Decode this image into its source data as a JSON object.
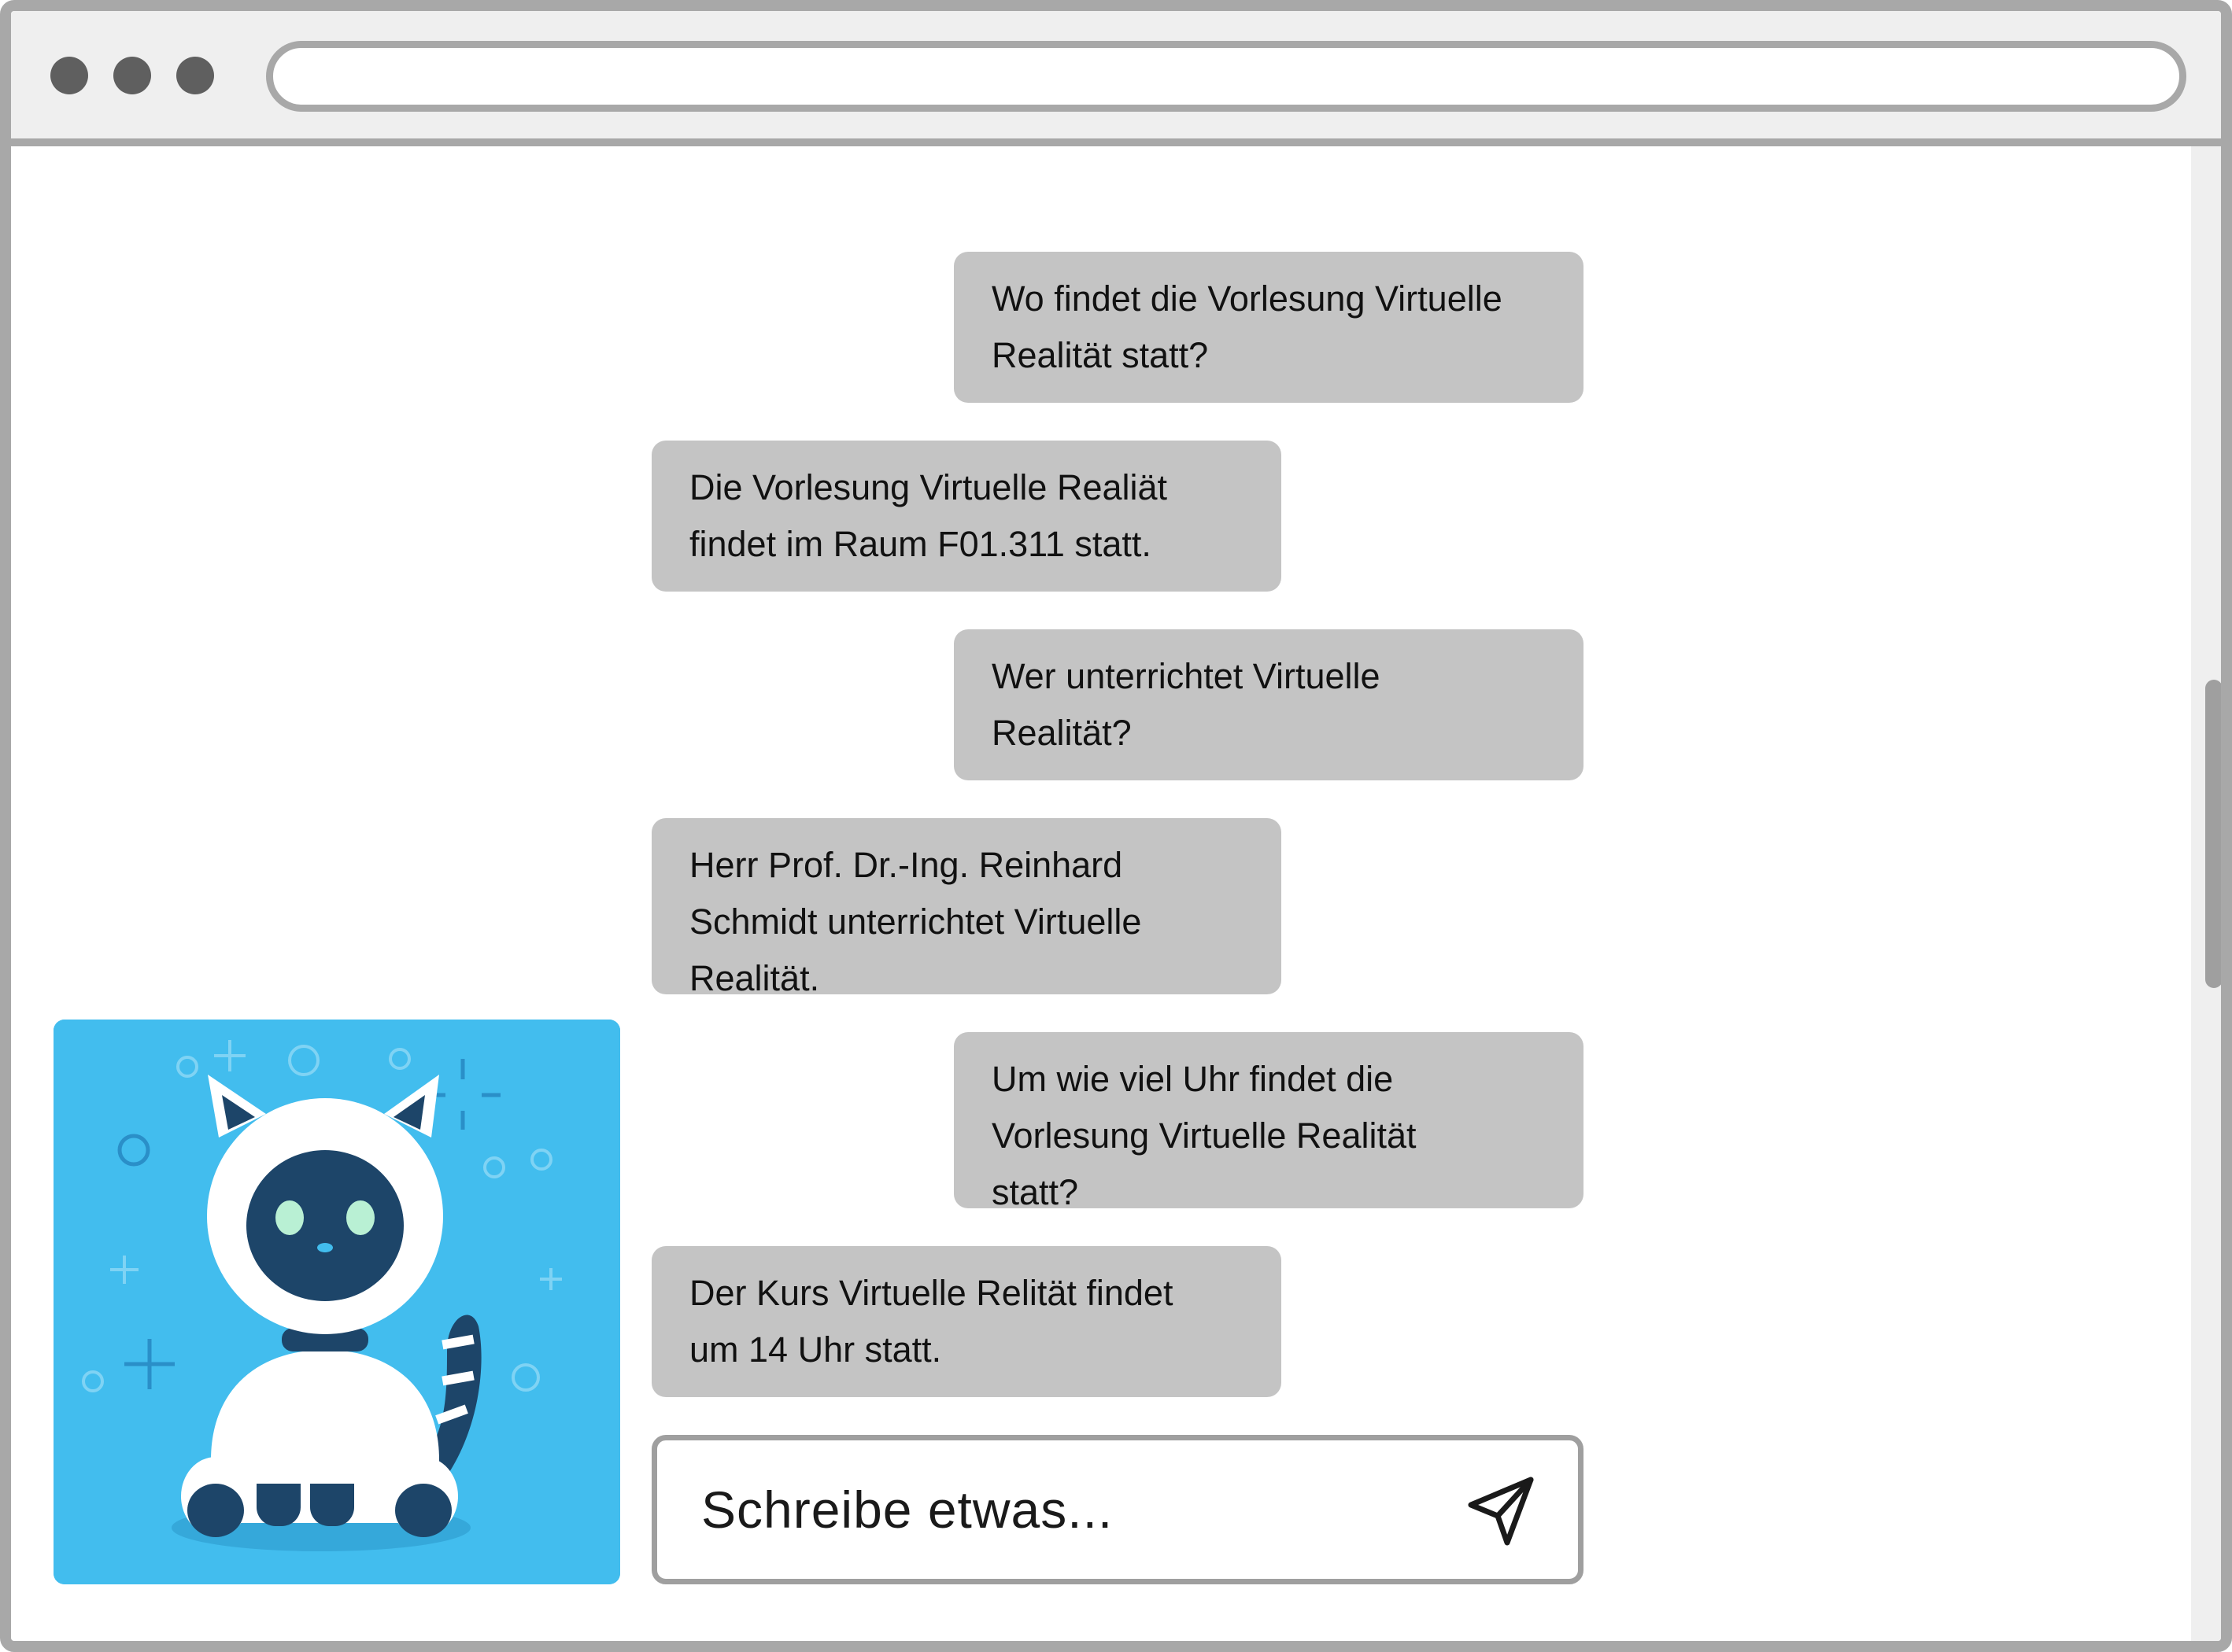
{
  "browser": {
    "controls": [
      "close-dot",
      "minimize-dot",
      "maximize-dot"
    ],
    "address_bar_value": ""
  },
  "chat": {
    "messages": [
      {
        "role": "user",
        "lines": [
          "Wo findet die Vorlesung Virtuelle",
          "Realität statt?"
        ]
      },
      {
        "role": "bot",
        "lines": [
          "Die Vorlesung Virtuelle Realiät",
          "findet im Raum F01.311 statt."
        ]
      },
      {
        "role": "user",
        "lines": [
          "Wer unterrichtet Virtuelle",
          "Realität?"
        ]
      },
      {
        "role": "bot",
        "lines": [
          "Herr Prof. Dr.-Ing. Reinhard",
          "Schmidt unterrichtet Virtuelle",
          "Realität."
        ]
      },
      {
        "role": "user",
        "lines": [
          "Um wie viel Uhr findet die",
          "Vorlesung Virtuelle Realität",
          "statt?"
        ]
      },
      {
        "role": "bot",
        "lines": [
          "Der Kurs Virtuelle Relität findet",
          "um 14 Uhr statt."
        ]
      }
    ],
    "input": {
      "placeholder": "Schreibe etwas...",
      "send_icon": "send-icon"
    },
    "avatar": {
      "icon": "robot-cat-icon",
      "background_color": "#42bdee"
    }
  },
  "colors": {
    "frame": "#a8a8a8",
    "bubble": "#c4c4c4",
    "titlebar": "#efefef",
    "avatar_dark": "#1d4569"
  }
}
